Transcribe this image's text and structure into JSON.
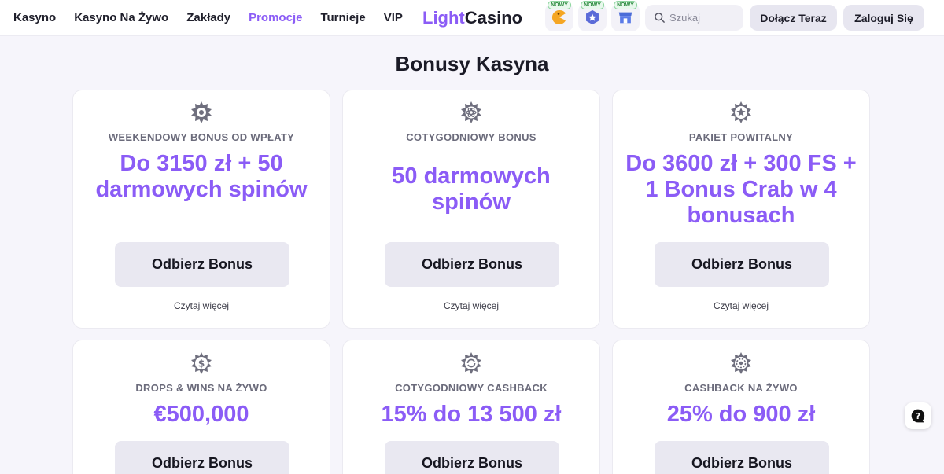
{
  "nav": {
    "items": [
      {
        "label": "Kasyno",
        "active": false
      },
      {
        "label": "Kasyno Na Żywo",
        "active": false
      },
      {
        "label": "Zakłady",
        "active": false
      },
      {
        "label": "Promocje",
        "active": true
      },
      {
        "label": "Turnieje",
        "active": false
      },
      {
        "label": "VIP",
        "active": false
      }
    ]
  },
  "logo": {
    "part1": "Light",
    "part2": "Casino"
  },
  "new_icons": [
    {
      "badge": "NOWY",
      "icon": "pacman-game-icon"
    },
    {
      "badge": "NOWY",
      "icon": "star-badge-icon"
    },
    {
      "badge": "NOWY",
      "icon": "shop-icon"
    }
  ],
  "search": {
    "placeholder": "Szukaj"
  },
  "header_buttons": {
    "join": "Dołącz Teraz",
    "login": "Zaloguj Się"
  },
  "page": {
    "title": "Bonusy Kasyna"
  },
  "cards": [
    {
      "icon": "burst-badge-icon",
      "title": "WEEKENDOWY BONUS OD WPŁATY",
      "value": "Do 3150 zł + 50 darmowych spinów",
      "button": "Odbierz Bonus",
      "more": "Czytaj więcej"
    },
    {
      "icon": "atom-badge-icon",
      "title": "COTYGODNIOWY BONUS",
      "value": "50 darmowych spinów",
      "button": "Odbierz Bonus",
      "more": "Czytaj więcej"
    },
    {
      "icon": "star-badge-icon",
      "title": "PAKIET POWITALNY",
      "value": "Do 3600 zł + 300 FS + 1 Bonus Crab w 4 bonusach",
      "button": "Odbierz Bonus",
      "more": "Czytaj więcej"
    },
    {
      "icon": "dollar-coin-icon",
      "title": "DROPS & WINS NA ŻYWO",
      "value": "€500,000",
      "button": "Odbierz Bonus",
      "more": ""
    },
    {
      "icon": "refresh-coin-icon",
      "title": "COTYGODNIOWY CASHBACK",
      "value": "15% do 13 500 zł",
      "button": "Odbierz Bonus",
      "more": ""
    },
    {
      "icon": "casino-chip-icon",
      "title": "CASHBACK NA ŻYWO",
      "value": "25% do 900 zł",
      "button": "Odbierz Bonus",
      "more": ""
    }
  ],
  "colors": {
    "accent": "#8b5cf6",
    "background": "#f6f5fb",
    "button": "#e9e8f1",
    "new_badge": "#2b8a3e"
  },
  "help": {
    "icon": "help-chat-icon"
  }
}
